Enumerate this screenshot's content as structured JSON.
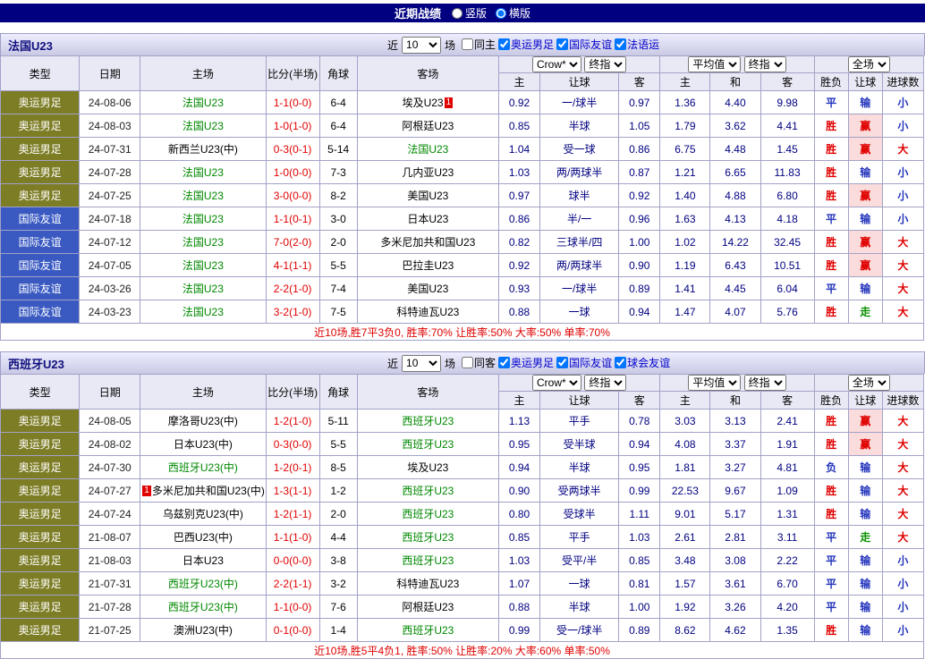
{
  "topbar": {
    "title": "近期战绩",
    "layout_options": [
      {
        "label": "竖版",
        "selected": false
      },
      {
        "label": "横版",
        "selected": true
      }
    ]
  },
  "ui": {
    "near_label": "近",
    "matches_label": "场"
  },
  "columns": {
    "type": "类型",
    "date": "日期",
    "home": "主场",
    "score": "比分(半场)",
    "corner": "角球",
    "away": "客场",
    "odds1_select": "Crow*",
    "odds1_time": "终指",
    "odds2_select": "平均值",
    "odds2_time": "终指",
    "scope_select": "全场",
    "sub1": [
      "主",
      "让球",
      "客"
    ],
    "sub2": [
      "主",
      "和",
      "客"
    ],
    "sub3": [
      "胜负",
      "让球",
      "进球数"
    ]
  },
  "type_colors": {
    "奥运男足": {
      "bg": "#7d7d26",
      "fg": "#ffffff"
    },
    "国际友谊": {
      "bg": "#3a5ac2",
      "fg": "#ffffff"
    }
  },
  "outcome_colors": {
    "胜": "#e00000",
    "平": "#2233bb",
    "负": "#2233bb",
    "赢": "#e00000",
    "输": "#2233bb",
    "走": "#089000",
    "大": "#e00000",
    "小": "#2233bb"
  },
  "win_text": "赢",
  "colors": {
    "topbar_bg": "#000080",
    "border": "#a2a2c8",
    "header_bg": "#e9e9f5",
    "focal_team": "#008800",
    "score": "#e00000",
    "odds": "#000080",
    "league_label": "#0000cc",
    "summary": "#e00000",
    "win_bg": "#fbdcdc",
    "badge_bg": "#e00000"
  },
  "sections": [
    {
      "team": "法国U23",
      "filter": {
        "count": "10",
        "checkboxes": [
          {
            "label": "同主",
            "checked": false,
            "blue": false
          },
          {
            "label": "奥运男足",
            "checked": true,
            "blue": true
          },
          {
            "label": "国际友谊",
            "checked": true,
            "blue": true
          },
          {
            "label": "法语运",
            "checked": true,
            "blue": true
          }
        ]
      },
      "rows": [
        {
          "type": "奥运男足",
          "date": "24-08-06",
          "home": "法国U23",
          "score": "1-1(0-0)",
          "corner": "6-4",
          "away": "埃及U23",
          "away_badge": "1",
          "away_badge_pos": "after",
          "odds": [
            "0.92",
            "一/球半",
            "0.97",
            "1.36",
            "4.40",
            "9.98"
          ],
          "result": [
            "平",
            "输",
            "小"
          ]
        },
        {
          "type": "奥运男足",
          "date": "24-08-03",
          "home": "法国U23",
          "score": "1-0(1-0)",
          "corner": "6-4",
          "away": "阿根廷U23",
          "odds": [
            "0.85",
            "半球",
            "1.05",
            "1.79",
            "3.62",
            "4.41"
          ],
          "result": [
            "胜",
            "赢",
            "小"
          ]
        },
        {
          "type": "奥运男足",
          "date": "24-07-31",
          "home": "新西兰U23(中)",
          "score": "0-3(0-1)",
          "corner": "5-14",
          "away": "法国U23",
          "odds": [
            "1.04",
            "受一球",
            "0.86",
            "6.75",
            "4.48",
            "1.45"
          ],
          "result": [
            "胜",
            "赢",
            "大"
          ]
        },
        {
          "type": "奥运男足",
          "date": "24-07-28",
          "home": "法国U23",
          "score": "1-0(0-0)",
          "corner": "7-3",
          "away": "几内亚U23",
          "odds": [
            "1.03",
            "两/两球半",
            "0.87",
            "1.21",
            "6.65",
            "11.83"
          ],
          "result": [
            "胜",
            "输",
            "小"
          ]
        },
        {
          "type": "奥运男足",
          "date": "24-07-25",
          "home": "法国U23",
          "score": "3-0(0-0)",
          "corner": "8-2",
          "away": "美国U23",
          "odds": [
            "0.97",
            "球半",
            "0.92",
            "1.40",
            "4.88",
            "6.80"
          ],
          "result": [
            "胜",
            "赢",
            "小"
          ]
        },
        {
          "type": "国际友谊",
          "date": "24-07-18",
          "home": "法国U23",
          "score": "1-1(0-1)",
          "corner": "3-0",
          "away": "日本U23",
          "odds": [
            "0.86",
            "半/一",
            "0.96",
            "1.63",
            "4.13",
            "4.18"
          ],
          "result": [
            "平",
            "输",
            "小"
          ]
        },
        {
          "type": "国际友谊",
          "date": "24-07-12",
          "home": "法国U23",
          "score": "7-0(2-0)",
          "corner": "2-0",
          "away": "多米尼加共和国U23",
          "odds": [
            "0.82",
            "三球半/四",
            "1.00",
            "1.02",
            "14.22",
            "32.45"
          ],
          "result": [
            "胜",
            "赢",
            "大"
          ]
        },
        {
          "type": "国际友谊",
          "date": "24-07-05",
          "home": "法国U23",
          "score": "4-1(1-1)",
          "corner": "5-5",
          "away": "巴拉圭U23",
          "odds": [
            "0.92",
            "两/两球半",
            "0.90",
            "1.19",
            "6.43",
            "10.51"
          ],
          "result": [
            "胜",
            "赢",
            "大"
          ]
        },
        {
          "type": "国际友谊",
          "date": "24-03-26",
          "home": "法国U23",
          "score": "2-2(1-0)",
          "corner": "7-4",
          "away": "美国U23",
          "odds": [
            "0.93",
            "一/球半",
            "0.89",
            "1.41",
            "4.45",
            "6.04"
          ],
          "result": [
            "平",
            "输",
            "大"
          ]
        },
        {
          "type": "国际友谊",
          "date": "24-03-23",
          "home": "法国U23",
          "score": "3-2(1-0)",
          "corner": "7-5",
          "away": "科特迪瓦U23",
          "odds": [
            "0.88",
            "一球",
            "0.94",
            "1.47",
            "4.07",
            "5.76"
          ],
          "result": [
            "胜",
            "走",
            "大"
          ]
        }
      ],
      "summary": "近10场,胜7平3负0, 胜率:70% 让胜率:50% 大率:50% 单率:70%"
    },
    {
      "team": "西班牙U23",
      "filter": {
        "count": "10",
        "checkboxes": [
          {
            "label": "同客",
            "checked": false,
            "blue": false
          },
          {
            "label": "奥运男足",
            "checked": true,
            "blue": true
          },
          {
            "label": "国际友谊",
            "checked": true,
            "blue": true
          },
          {
            "label": "球会友谊",
            "checked": true,
            "blue": true
          }
        ]
      },
      "rows": [
        {
          "type": "奥运男足",
          "date": "24-08-05",
          "home": "摩洛哥U23(中)",
          "score": "1-2(1-0)",
          "corner": "5-11",
          "away": "西班牙U23",
          "odds": [
            "1.13",
            "平手",
            "0.78",
            "3.03",
            "3.13",
            "2.41"
          ],
          "result": [
            "胜",
            "赢",
            "大"
          ]
        },
        {
          "type": "奥运男足",
          "date": "24-08-02",
          "home": "日本U23(中)",
          "score": "0-3(0-0)",
          "corner": "5-5",
          "away": "西班牙U23",
          "odds": [
            "0.95",
            "受半球",
            "0.94",
            "4.08",
            "3.37",
            "1.91"
          ],
          "result": [
            "胜",
            "赢",
            "大"
          ]
        },
        {
          "type": "奥运男足",
          "date": "24-07-30",
          "home": "西班牙U23(中)",
          "score": "1-2(0-1)",
          "corner": "8-5",
          "away": "埃及U23",
          "odds": [
            "0.94",
            "半球",
            "0.95",
            "1.81",
            "3.27",
            "4.81"
          ],
          "result": [
            "负",
            "输",
            "大"
          ]
        },
        {
          "type": "奥运男足",
          "date": "24-07-27",
          "home": "多米尼加共和国U23(中)",
          "home_badge": "1",
          "home_badge_pos": "before",
          "score": "1-3(1-1)",
          "corner": "1-2",
          "away": "西班牙U23",
          "odds": [
            "0.90",
            "受两球半",
            "0.99",
            "22.53",
            "9.67",
            "1.09"
          ],
          "result": [
            "胜",
            "输",
            "大"
          ]
        },
        {
          "type": "奥运男足",
          "date": "24-07-24",
          "home": "乌兹别克U23(中)",
          "score": "1-2(1-1)",
          "corner": "2-0",
          "away": "西班牙U23",
          "odds": [
            "0.80",
            "受球半",
            "1.11",
            "9.01",
            "5.17",
            "1.31"
          ],
          "result": [
            "胜",
            "输",
            "大"
          ]
        },
        {
          "type": "奥运男足",
          "date": "21-08-07",
          "home": "巴西U23(中)",
          "score": "1-1(1-0)",
          "corner": "4-4",
          "away": "西班牙U23",
          "odds": [
            "0.85",
            "平手",
            "1.03",
            "2.61",
            "2.81",
            "3.11"
          ],
          "result": [
            "平",
            "走",
            "大"
          ]
        },
        {
          "type": "奥运男足",
          "date": "21-08-03",
          "home": "日本U23",
          "score": "0-0(0-0)",
          "corner": "3-8",
          "away": "西班牙U23",
          "odds": [
            "1.03",
            "受平/半",
            "0.85",
            "3.48",
            "3.08",
            "2.22"
          ],
          "result": [
            "平",
            "输",
            "小"
          ]
        },
        {
          "type": "奥运男足",
          "date": "21-07-31",
          "home": "西班牙U23(中)",
          "score": "2-2(1-1)",
          "corner": "3-2",
          "away": "科特迪瓦U23",
          "odds": [
            "1.07",
            "一球",
            "0.81",
            "1.57",
            "3.61",
            "6.70"
          ],
          "result": [
            "平",
            "输",
            "小"
          ]
        },
        {
          "type": "奥运男足",
          "date": "21-07-28",
          "home": "西班牙U23(中)",
          "score": "1-1(0-0)",
          "corner": "7-6",
          "away": "阿根廷U23",
          "odds": [
            "0.88",
            "半球",
            "1.00",
            "1.92",
            "3.26",
            "4.20"
          ],
          "result": [
            "平",
            "输",
            "小"
          ]
        },
        {
          "type": "奥运男足",
          "date": "21-07-25",
          "home": "澳洲U23(中)",
          "score": "0-1(0-0)",
          "corner": "1-4",
          "away": "西班牙U23",
          "odds": [
            "0.99",
            "受一/球半",
            "0.89",
            "8.62",
            "4.62",
            "1.35"
          ],
          "result": [
            "胜",
            "输",
            "小"
          ]
        }
      ],
      "summary": "近10场,胜5平4负1, 胜率:50% 让胜率:20% 大率:60% 单率:50%"
    }
  ]
}
